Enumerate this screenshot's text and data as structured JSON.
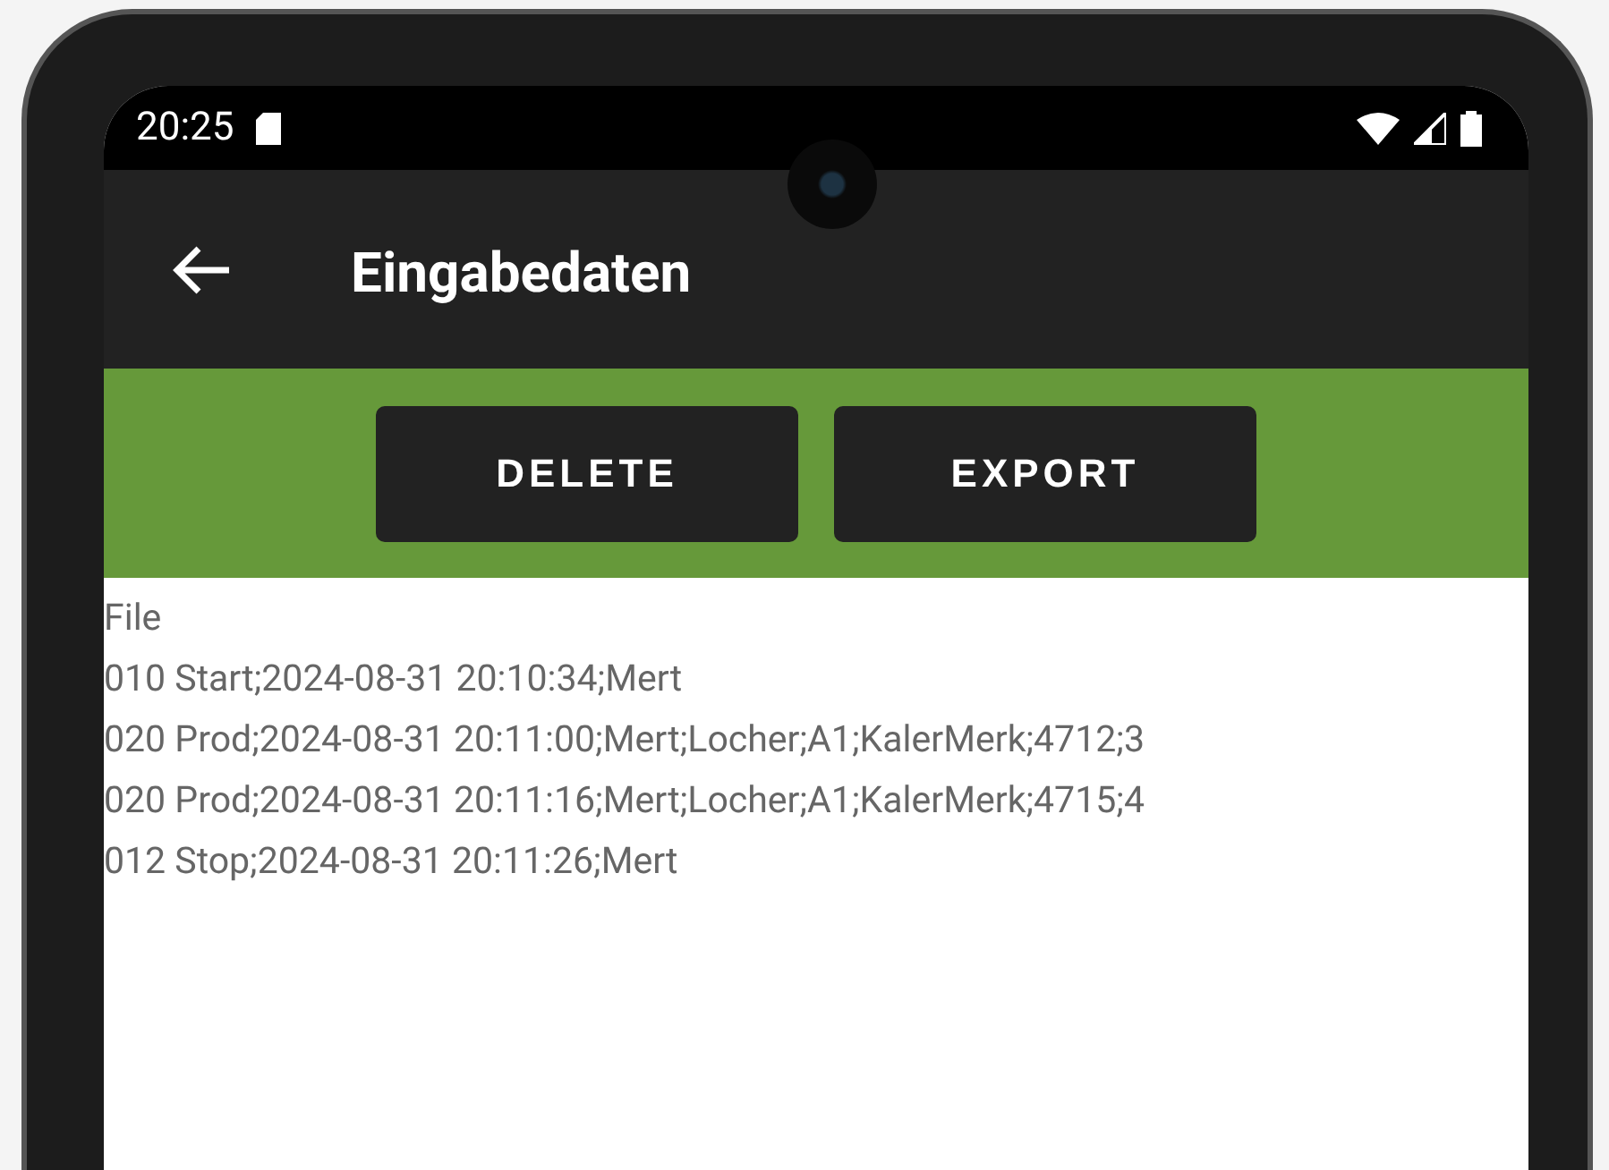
{
  "status_bar": {
    "time": "20:25"
  },
  "app_bar": {
    "title": "Eingabedaten"
  },
  "buttons": [
    {
      "label": "DELETE"
    },
    {
      "label": "EXPORT"
    }
  ],
  "content": {
    "heading": "File",
    "lines": [
      "010 Start;2024-08-31 20:10:34;Mert",
      "020 Prod;2024-08-31 20:11:00;Mert;Locher;A1;KalerMerk;4712;3",
      "020 Prod;2024-08-31 20:11:16;Mert;Locher;A1;KalerMerk;4715;4",
      "012 Stop;2024-08-31 20:11:26;Mert"
    ]
  }
}
